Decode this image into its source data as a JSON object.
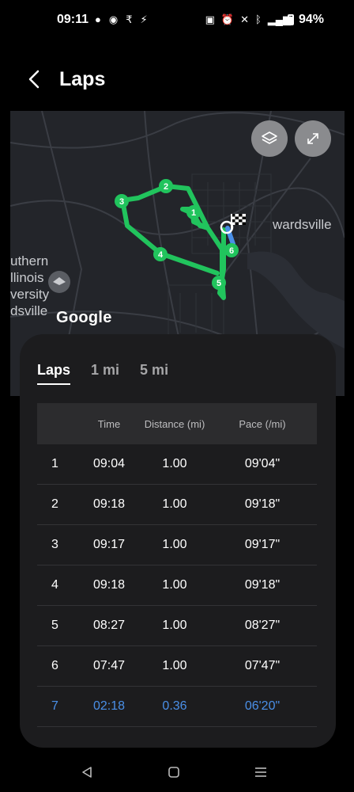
{
  "status_bar": {
    "time": "09:11",
    "battery": "94%",
    "left_icons": [
      "chat-icon",
      "sync-icon",
      "rupee-icon",
      "signal-icon"
    ],
    "right_icons": [
      "nfc-icon",
      "alarm-icon",
      "mute-icon",
      "bluetooth-icon",
      "5g-signal-icon",
      "battery-icon"
    ]
  },
  "header": {
    "title": "Laps"
  },
  "map": {
    "logo": "Google",
    "labels": {
      "town": "wardsville",
      "univ_line1": "uthern",
      "univ_line2": "llinois",
      "univ_line3": "versity",
      "univ_line4": "dsville"
    },
    "lap_markers": [
      "1",
      "2",
      "3",
      "4",
      "5",
      "6"
    ],
    "route_color": "#21c45d",
    "current_lap_color": "#4a8fe7"
  },
  "tabs": [
    {
      "label": "Laps",
      "active": true
    },
    {
      "label": "1 mi",
      "active": false
    },
    {
      "label": "5 mi",
      "active": false
    }
  ],
  "table": {
    "headers": {
      "num": "",
      "time": "Time",
      "distance": "Distance (mi)",
      "pace": "Pace (/mi)"
    },
    "rows": [
      {
        "num": "1",
        "time": "09:04",
        "distance": "1.00",
        "pace": "09'04\""
      },
      {
        "num": "2",
        "time": "09:18",
        "distance": "1.00",
        "pace": "09'18\""
      },
      {
        "num": "3",
        "time": "09:17",
        "distance": "1.00",
        "pace": "09'17\""
      },
      {
        "num": "4",
        "time": "09:18",
        "distance": "1.00",
        "pace": "09'18\""
      },
      {
        "num": "5",
        "time": "08:27",
        "distance": "1.00",
        "pace": "08'27\""
      },
      {
        "num": "6",
        "time": "07:47",
        "distance": "1.00",
        "pace": "07'47\""
      },
      {
        "num": "7",
        "time": "02:18",
        "distance": "0.36",
        "pace": "06'20\""
      }
    ]
  },
  "navbar": {
    "items": [
      "back-nav-icon",
      "home-nav-icon",
      "recents-nav-icon"
    ]
  }
}
